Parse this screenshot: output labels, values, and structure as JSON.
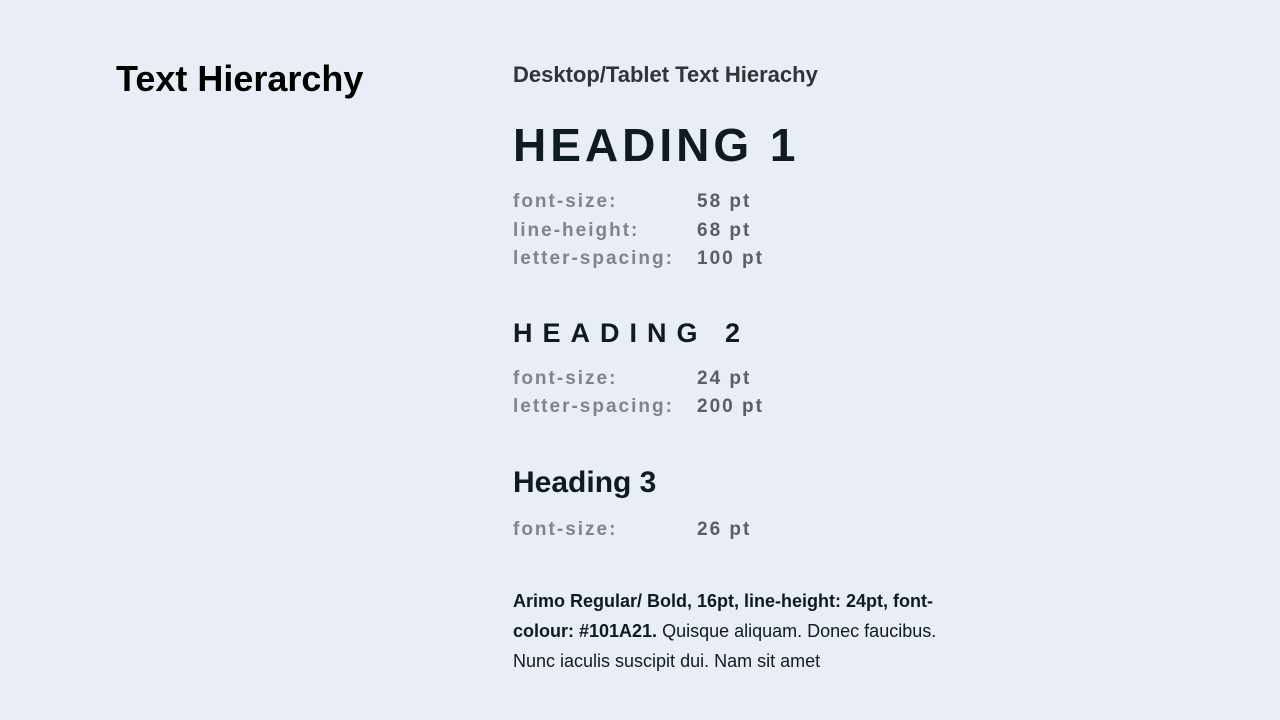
{
  "page": {
    "title": "Text Hierarchy",
    "section_title": "Desktop/Tablet Text Hierachy"
  },
  "heading1": {
    "text": "HEADING 1",
    "specs": [
      {
        "label": "font-size:",
        "value": "58 pt"
      },
      {
        "label": "line-height:",
        "value": "68 pt"
      },
      {
        "label": "letter-spacing:",
        "value": "100 pt"
      }
    ]
  },
  "heading2": {
    "text": "HEADING 2",
    "specs": [
      {
        "label": "font-size:",
        "value": "24 pt"
      },
      {
        "label": "letter-spacing:",
        "value": "200 pt"
      }
    ]
  },
  "heading3": {
    "text": "Heading 3",
    "specs": [
      {
        "label": "font-size:",
        "value": "26 pt"
      }
    ]
  },
  "body": {
    "bold": "Arimo Regular/ Bold, 16pt, line-height: 24pt, font-colour: #101A21.",
    "regular": " Quisque aliquam. Donec faucibus. Nunc iaculis suscipit dui. Nam sit amet"
  }
}
